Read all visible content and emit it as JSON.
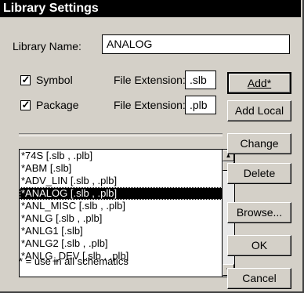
{
  "window": {
    "title": "Library Settings",
    "close_glyph": "×"
  },
  "library_name": {
    "label": "Library Name:",
    "value": "ANALOG"
  },
  "symbol": {
    "checkbox_label": "Symbol",
    "checked": true,
    "ext_label": "File Extension:",
    "ext_value": ".slb"
  },
  "package": {
    "checkbox_label": "Package",
    "checked": true,
    "ext_label": "File Extension:",
    "ext_value": ".plb"
  },
  "list": {
    "items": [
      "*74S [.slb , .plb]",
      "*ABM [.slb]",
      "*ADV_LIN [.slb , .plb]",
      "*ANALOG [.slb , .plb]",
      "*ANL_MISC [.slb , .plb]",
      "*ANLG [.slb , .plb]",
      "*ANLG1 [.slb]",
      "*ANLG2 [.slb , .plb]",
      "*ANLG_DEV [.slb , .plb]"
    ],
    "selected_index": 3
  },
  "footnote": "* = use in all schematics",
  "buttons": {
    "add": "Add*",
    "add_local": "Add Local",
    "change": "Change",
    "delete": "Delete",
    "browse": "Browse...",
    "ok": "OK",
    "cancel": "Cancel"
  },
  "icons": {
    "scroll_up": "triangle-up-icon",
    "scroll_down": "triangle-down-icon",
    "check": "check-icon"
  }
}
